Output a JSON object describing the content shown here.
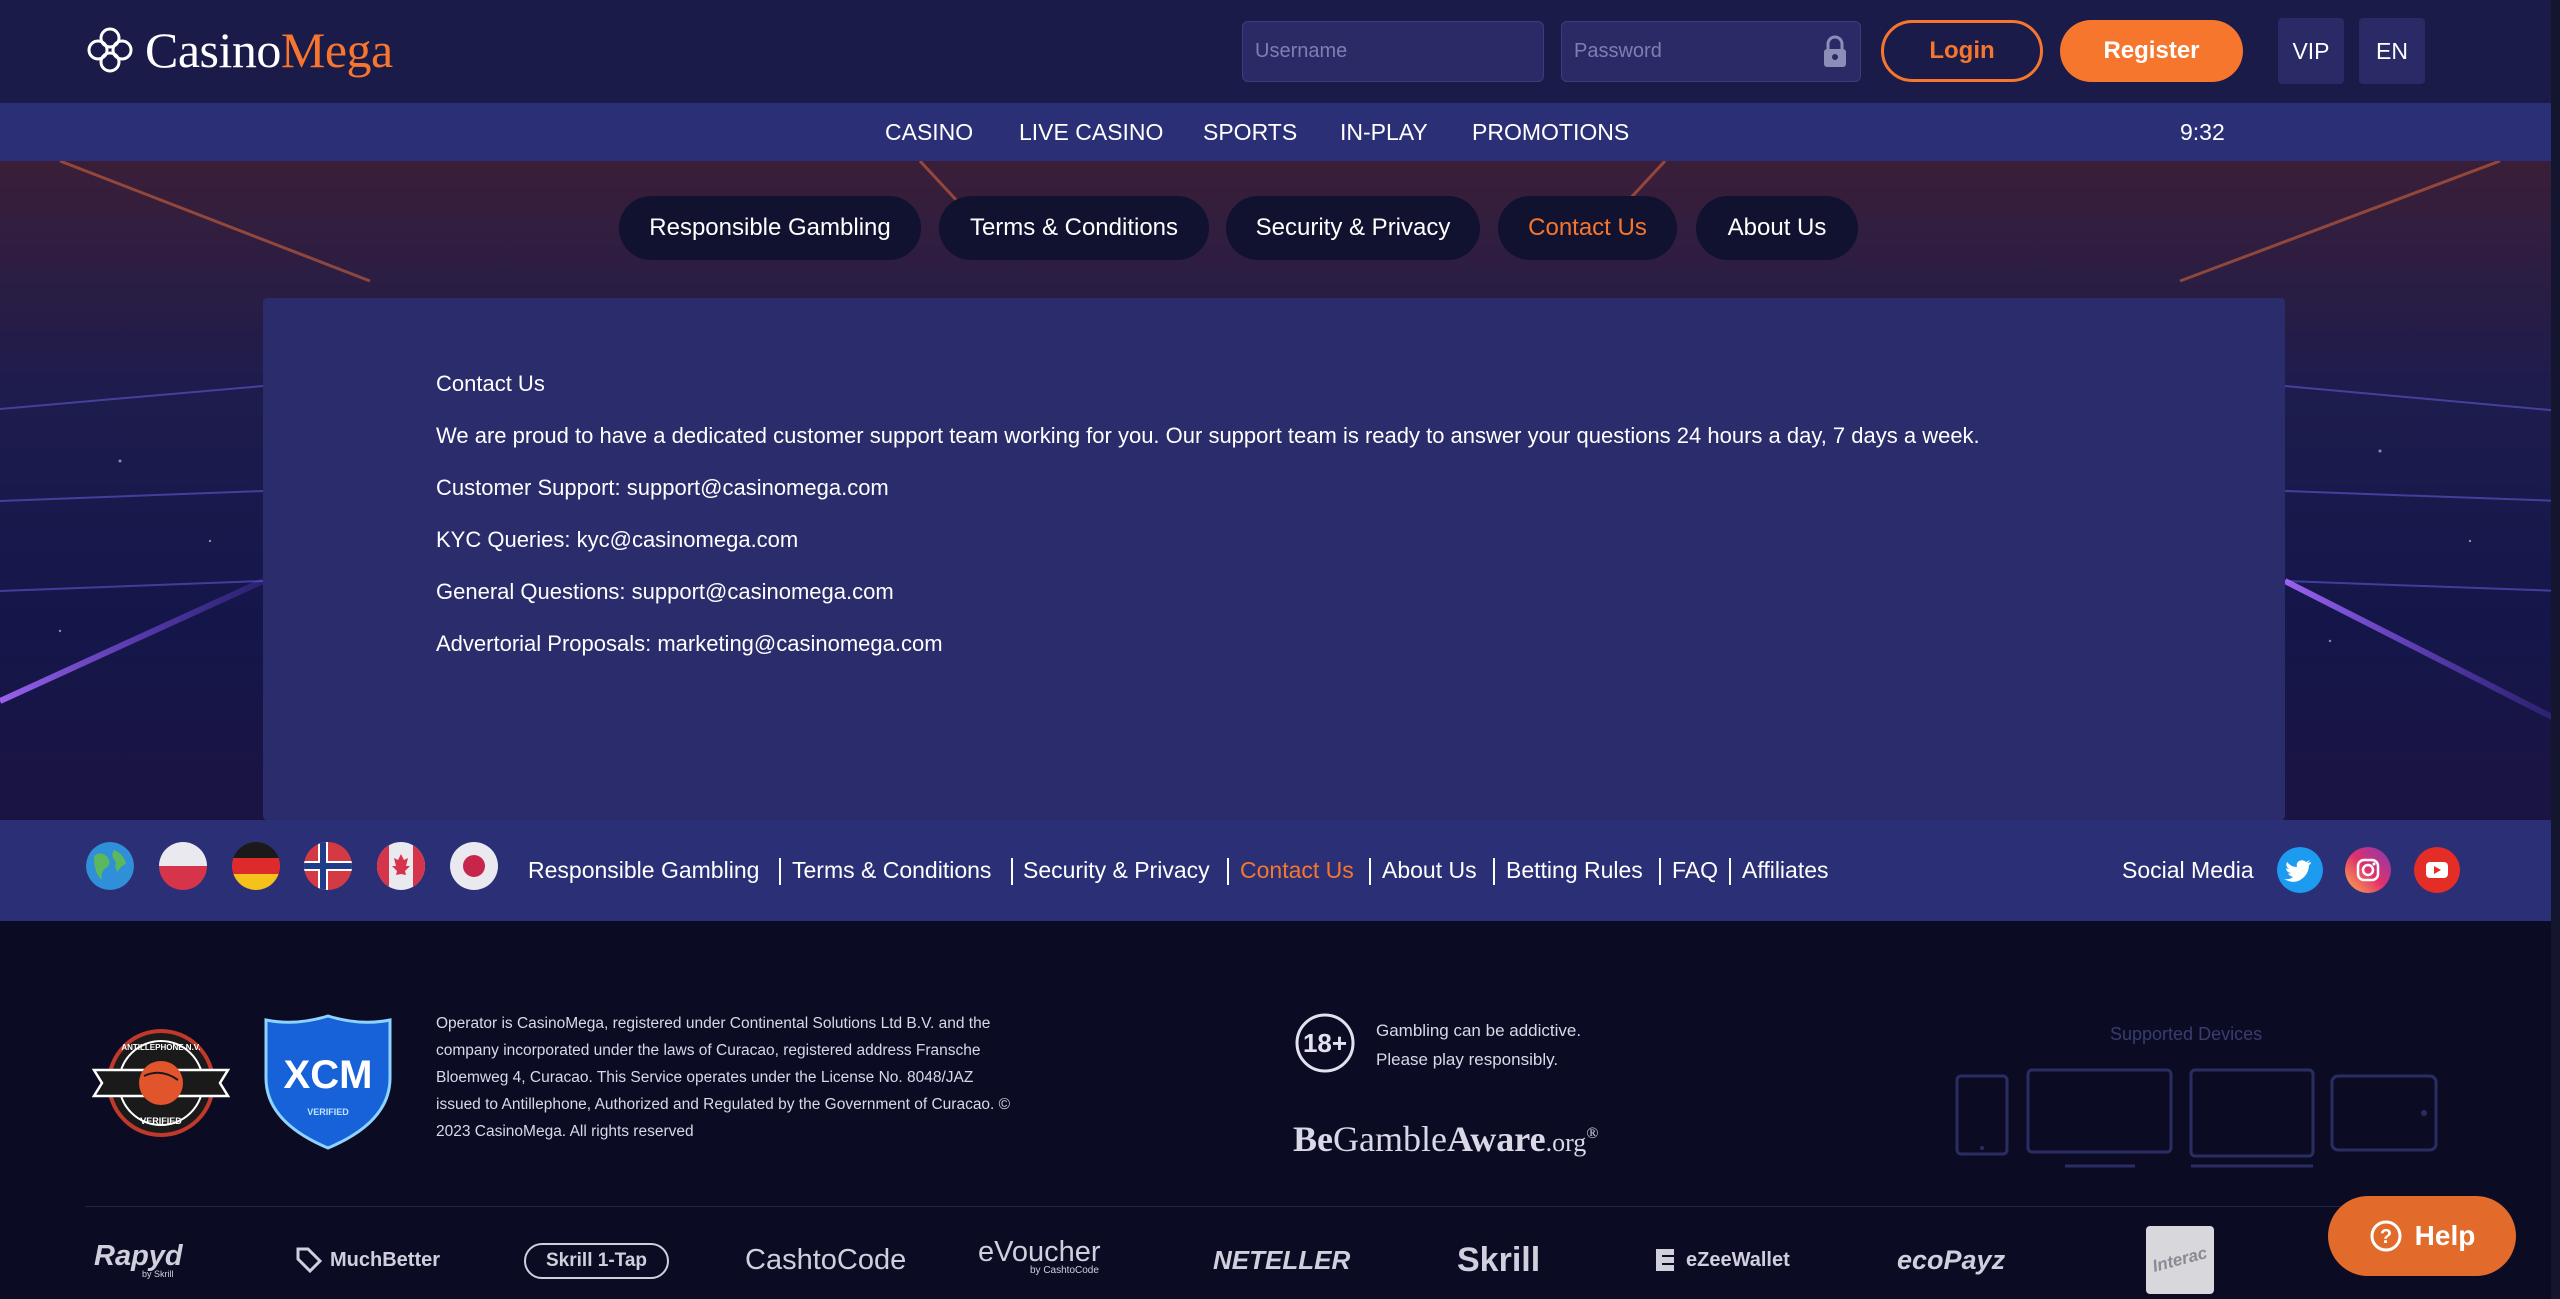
{
  "brand": {
    "name_white": "Casino",
    "name_orange": "Mega",
    "accent": "#f6762d"
  },
  "auth": {
    "username_placeholder": "Username",
    "password_placeholder": "Password",
    "login_label": "Login",
    "register_label": "Register",
    "vip_label": "VIP",
    "lang_label": "EN"
  },
  "nav": {
    "items": [
      "CASINO",
      "LIVE CASINO",
      "SPORTS",
      "IN-PLAY",
      "PROMOTIONS"
    ],
    "time": "9:32"
  },
  "tabs": [
    {
      "label": "Responsible Gambling",
      "active": false
    },
    {
      "label": "Terms & Conditions",
      "active": false
    },
    {
      "label": "Security & Privacy",
      "active": false
    },
    {
      "label": "Contact Us",
      "active": true
    },
    {
      "label": "About Us",
      "active": false
    }
  ],
  "content": {
    "heading": "Contact Us",
    "intro": "We are proud to have a dedicated customer support team working for you. Our support team is ready to answer your questions 24 hours a day, 7 days a week.",
    "lines": [
      "Customer Support: support@casinomega.com",
      "KYC Queries: kyc@casinomega.com",
      "General Questions: support@casinomega.com",
      "Advertorial Proposals: marketing@casinomega.com"
    ]
  },
  "footer_links": {
    "flags": [
      "globe-icon",
      "poland-flag-icon",
      "germany-flag-icon",
      "norway-flag-icon",
      "canada-flag-icon",
      "japan-flag-icon"
    ],
    "items": [
      "Responsible Gambling",
      "Terms & Conditions",
      "Security & Privacy",
      "Contact Us",
      "About Us",
      "Betting Rules",
      "FAQ",
      "Affiliates"
    ],
    "active": "Contact Us",
    "social_label": "Social Media",
    "social": [
      "twitter-icon",
      "instagram-icon",
      "youtube-icon"
    ]
  },
  "footer": {
    "badge1_top": "ANTILLEPHONE N.V.",
    "badge1_bottom": "VERIFIED",
    "badge2_logo": "XCM",
    "badge2_label": "VERIFIED",
    "legal": "Operator is CasinoMega, registered under Continental Solutions Ltd B.V. and the company incorporated under the laws of Curacao, registered address Fransche Bloemweg 4, Curacao. This Service operates under the License No. 8048/JAZ issued to Antillephone, Authorized and Regulated by the Government of Curacao. © 2023 CasinoMega. All rights reserved",
    "age_badge": "18+",
    "age_line1": "Gambling can be addictive.",
    "age_line2": "Please play responsibly.",
    "bga_a": "Be",
    "bga_b": "Gamble",
    "bga_c": "Aware",
    "bga_d": ".org",
    "devices_label": "Supported Devices"
  },
  "payments": [
    "Rapyd",
    "MuchBetter",
    "Skrill 1-Tap",
    "CashtoCode",
    "eVoucher",
    "NETELLER",
    "Skrill",
    "eZeeWallet",
    "ecoPayz",
    "Interac"
  ],
  "payment_subs": {
    "rapyd": "by Skrill",
    "evoucher": "by CashtoCode"
  },
  "help_label": "Help"
}
